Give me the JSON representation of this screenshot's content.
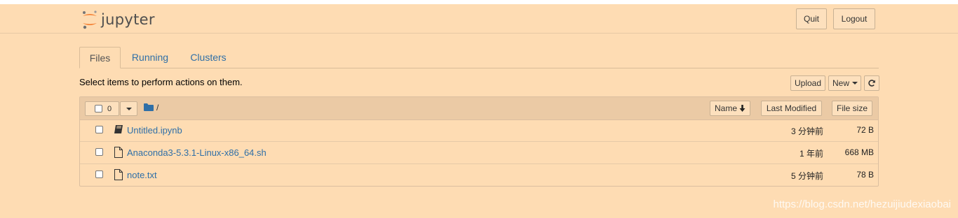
{
  "header": {
    "logo_text": "jupyter",
    "quit_label": "Quit",
    "logout_label": "Logout"
  },
  "tabs": [
    {
      "label": "Files",
      "active": true
    },
    {
      "label": "Running",
      "active": false
    },
    {
      "label": "Clusters",
      "active": false
    }
  ],
  "toolbar": {
    "hint": "Select items to perform actions on them.",
    "upload_label": "Upload",
    "new_label": "New",
    "refresh_icon": "refresh-icon"
  },
  "list_header": {
    "selected_count": "0",
    "path": "/",
    "sort_name_label": "Name",
    "last_modified_label": "Last Modified",
    "file_size_label": "File size"
  },
  "files": [
    {
      "name": "Untitled.ipynb",
      "modified": "3 分钟前",
      "size": "72 B",
      "icon": "notebook-icon"
    },
    {
      "name": "Anaconda3-5.3.1-Linux-x86_64.sh",
      "modified": "1 年前",
      "size": "668 MB",
      "icon": "file-icon"
    },
    {
      "name": "note.txt",
      "modified": "5 分钟前",
      "size": "78 B",
      "icon": "file-icon"
    }
  ],
  "watermark": "https://blog.csdn.net/hezuijiudexiaobai",
  "colors": {
    "background": "#fedcb3",
    "link": "#2f6fa7",
    "logo_orange": "#f37726"
  }
}
